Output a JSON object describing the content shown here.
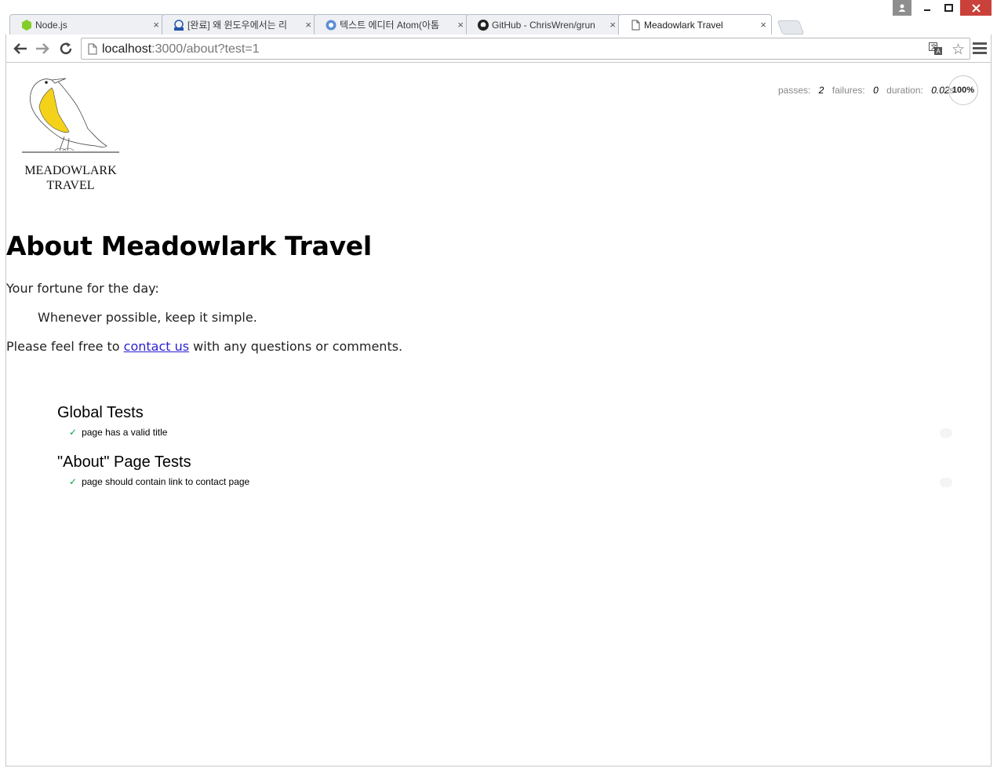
{
  "window": {
    "tabs": [
      {
        "title": "Node.js",
        "icon": "nodejs-icon"
      },
      {
        "title": "[완료] 왜 윈도우에서는 리",
        "icon": "okjsp-icon"
      },
      {
        "title": "텍스트 에디터 Atom(아톰",
        "icon": "atom-icon"
      },
      {
        "title": "GitHub - ChrisWren/grun",
        "icon": "github-icon"
      },
      {
        "title": "Meadowlark Travel",
        "icon": "page-icon"
      }
    ],
    "close_glyph": "×"
  },
  "toolbar": {
    "url_host": "localhost",
    "url_rest": ":3000/about?test=1"
  },
  "page": {
    "logo_line1": "MEADOWLARK",
    "logo_line2": "TRAVEL",
    "heading": "About Meadowlark Travel",
    "fortune_label": "Your fortune for the day:",
    "fortune": "Whenever possible, keep it simple.",
    "contact_prefix": "Please feel free to ",
    "contact_link": "contact us",
    "contact_suffix": " with any questions or comments."
  },
  "mocha": {
    "passes_label": "passes:",
    "passes": "2",
    "failures_label": "failures:",
    "failures": "0",
    "duration_label": "duration:",
    "duration": "0.02",
    "duration_unit": "s",
    "progress": "100%",
    "suites": [
      {
        "title": "Global Tests",
        "tests": [
          "page has a valid title"
        ]
      },
      {
        "title": "\"About\" Page Tests",
        "tests": [
          "page should contain link to contact page"
        ]
      }
    ],
    "check_glyph": "✓"
  },
  "colors": {
    "accent_close": "#c9413a",
    "link": "#2a1fd0",
    "pass": "#00a550",
    "bird_yellow": "#f5d21a"
  }
}
